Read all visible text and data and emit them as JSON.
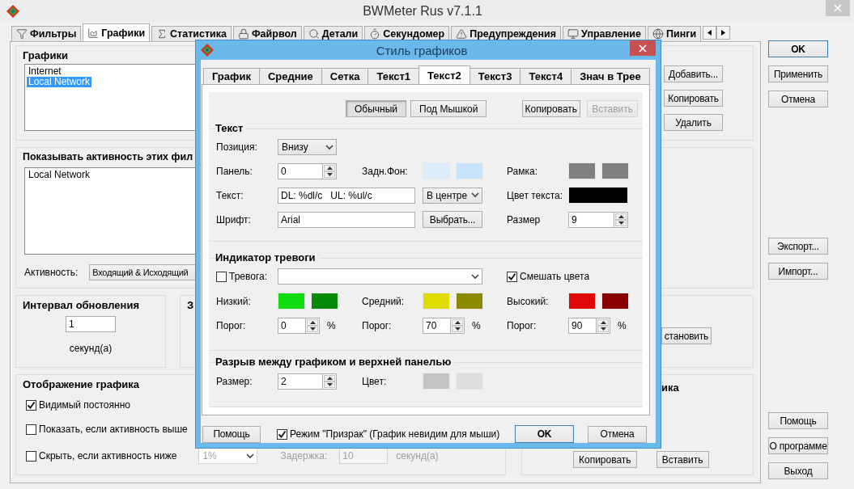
{
  "window": {
    "title": "BWMeter Rus v7.1.1"
  },
  "tabs": [
    {
      "label": "Фильтры",
      "selected": false
    },
    {
      "label": "Графики",
      "selected": true
    },
    {
      "label": "Статистика",
      "selected": false
    },
    {
      "label": "Файрвол",
      "selected": false
    },
    {
      "label": "Детали",
      "selected": false
    },
    {
      "label": "Секундомер",
      "selected": false
    },
    {
      "label": "Предупреждения",
      "selected": false
    },
    {
      "label": "Управление",
      "selected": false
    },
    {
      "label": "Пинги",
      "selected": false
    }
  ],
  "graphs": {
    "heading": "Графики",
    "items": [
      {
        "label": "Internet",
        "selected": false
      },
      {
        "label": "Local Network",
        "selected": true
      }
    ],
    "buttons": [
      "Добавить...",
      "Копировать",
      "Удалить"
    ]
  },
  "filters": {
    "heading": "Показывать активность этих фил",
    "items": [
      "Local Network"
    ],
    "activity_label": "Активность:",
    "activity_value": "Входящий & Исходящий"
  },
  "interval": {
    "heading": "Интервал обновления",
    "value": "1",
    "unit": "секунд(а)"
  },
  "section_3": {
    "heading": "З",
    "button": "становить"
  },
  "display": {
    "heading": "Отображение графика",
    "options": [
      {
        "label": "Видимый постоянно",
        "checked": true
      },
      {
        "label": "Показать, если активность выше",
        "checked": false
      },
      {
        "label": "Скрыть, если активность ниже",
        "checked": false
      }
    ],
    "threshold": {
      "value": "1%",
      "disabled": true
    },
    "delay": {
      "label": "Задержка:",
      "value": "10",
      "unit": "секунд(а)",
      "disabled": true
    }
  },
  "section_5": {
    "heading": "ика",
    "buttons": [
      "Копировать",
      "Вставить"
    ]
  },
  "side_buttons": {
    "top": [
      {
        "label": "OK",
        "default": true
      },
      {
        "label": "Применить",
        "default": false
      },
      {
        "label": "Отмена",
        "default": false
      }
    ],
    "middle": [
      {
        "label": "Экспорт...",
        "default": false
      },
      {
        "label": "Импорт...",
        "default": false
      }
    ],
    "bottom": [
      {
        "label": "Помощь",
        "default": false
      },
      {
        "label": "О программе",
        "default": false
      },
      {
        "label": "Выход",
        "default": false
      }
    ]
  },
  "dialog": {
    "title": "Стиль графиков",
    "tabs": [
      {
        "label": "График",
        "selected": false
      },
      {
        "label": "Средние",
        "selected": false
      },
      {
        "label": "Сетка",
        "selected": false
      },
      {
        "label": "Текст1",
        "selected": false
      },
      {
        "label": "Текст2",
        "selected": true
      },
      {
        "label": "Текст3",
        "selected": false
      },
      {
        "label": "Текст4",
        "selected": false
      },
      {
        "label": "Знач в Трее",
        "selected": false
      }
    ],
    "modes": [
      {
        "label": "Обычный",
        "selected": true
      },
      {
        "label": "Под Мышкой",
        "selected": false
      }
    ],
    "copy": "Копировать",
    "paste": {
      "label": "Вставить",
      "disabled": true
    },
    "text": {
      "heading": "Текст",
      "position_label": "Позиция:",
      "position": "Внизу",
      "panel_label": "Панель:",
      "panel": "0",
      "bg_label": "Задн.Фон:",
      "bg_colors": [
        {
          "color": "#dcecfc"
        },
        {
          "color": "#c8e2fa"
        }
      ],
      "frame_label": "Рамка:",
      "frame_colors": [
        {
          "color": "#808080"
        },
        {
          "color": "#808080"
        }
      ],
      "text_label": "Текст:",
      "text": "DL: %dl/c   UL: %ul/c",
      "align": "В центре",
      "text_color_label": "Цвет текста:",
      "text_color": {
        "color": "#000000"
      },
      "font_label": "Шрифт:",
      "font": "Arial",
      "choose": "Выбрать...",
      "size_label": "Размер",
      "size": "9"
    },
    "alarm": {
      "heading": "Индикатор тревоги",
      "alarm": {
        "label": "Тревога:",
        "checked": false
      },
      "mix": {
        "label": "Смешать цвета",
        "checked": true
      },
      "levels": [
        {
          "label": "Низкий:",
          "colors": [
            {
              "color": "#10dc10"
            },
            {
              "color": "#088a08"
            }
          ],
          "threshold_label": "Порог:",
          "threshold": "0",
          "unit": "%"
        },
        {
          "label": "Средний:",
          "colors": [
            {
              "color": "#e0dc00"
            },
            {
              "color": "#8c8a00"
            }
          ],
          "threshold_label": "Порог:",
          "threshold": "70",
          "unit": "%"
        },
        {
          "label": "Высокий:",
          "colors": [
            {
              "color": "#e00808"
            },
            {
              "color": "#8a0000"
            }
          ],
          "threshold_label": "Порог:",
          "threshold": "90",
          "unit": "%"
        }
      ]
    },
    "gap": {
      "heading": "Разрыв между графиком и верхней панелью",
      "size_label": "Размер:",
      "size": "2",
      "color_label": "Цвет:",
      "colors": [
        {
          "color": "#c4c4c4"
        },
        {
          "color": "#dcdcdc"
        }
      ]
    },
    "help": "Помощь",
    "ghost": {
      "label": "Режим \"Призрак\" (График невидим для мыши)",
      "checked": true
    },
    "ok": "OK",
    "cancel": "Отмена"
  }
}
